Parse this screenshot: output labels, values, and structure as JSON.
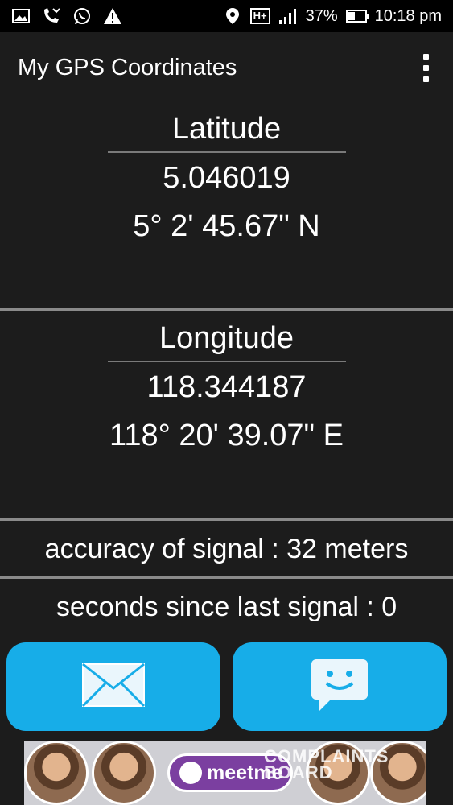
{
  "status_bar": {
    "icons_left": [
      "image-icon",
      "missed-call-icon",
      "whatsapp-icon",
      "warning-icon"
    ],
    "icons_right": [
      "location-icon",
      "network-hplus-icon",
      "signal-icon",
      "battery-icon"
    ],
    "network_label": "H+",
    "battery": "37%",
    "battery_level": 0.37,
    "time": "10:18 pm"
  },
  "appbar": {
    "title": "My GPS Coordinates",
    "overflow_icon": "more-vert-icon"
  },
  "latitude": {
    "title": "Latitude",
    "decimal": "5.046019",
    "dms": "5° 2' 45.67\" N"
  },
  "longitude": {
    "title": "Longitude",
    "decimal": "118.344187",
    "dms": "118° 20' 39.07\" E"
  },
  "accuracy": {
    "text": "accuracy of signal : 32 meters"
  },
  "last_signal": {
    "text": "seconds since last signal : 0"
  },
  "buttons": [
    {
      "icon": "email-icon",
      "action": "email"
    },
    {
      "icon": "sms-icon",
      "action": "sms"
    }
  ],
  "colors": {
    "background": "#1c1c1c",
    "button": "#17ade8",
    "divider": "#8a8a8a"
  },
  "ad": {
    "brand": "meetme",
    "watermark": "COMPLAINTS BOARD"
  }
}
